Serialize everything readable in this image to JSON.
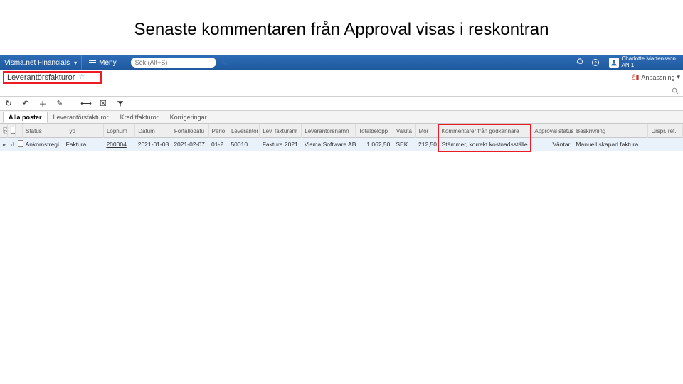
{
  "slide_title": "Senaste kommentaren från Approval visas i reskontran",
  "brand": "Visma.net Financials",
  "menu_label": "Meny",
  "search_placeholder": "Sök (Alt+S)",
  "user": {
    "name": "Charlotte Martensson",
    "org": "AN 1"
  },
  "breadcrumb": "Leverantörsfakturor",
  "anpassning_label": "Anpassning",
  "tabs": [
    "Alla poster",
    "Leverantörsfakturor",
    "Kreditfakturor",
    "Korrigeringar"
  ],
  "columns": {
    "status": "Status",
    "typ": "Typ",
    "lopnum": "Löpnum",
    "datum": "Datum",
    "forfallodatu": "Förfallodatu",
    "perio": "Perio",
    "leverantor": "Leverantör",
    "levfakturanr": "Lev. fakturanr",
    "leverantorsnamn": "Leverantörsnamn",
    "totalbelopp": "Totalbelopp",
    "valuta": "Valuta",
    "mor": "Mor",
    "kommentarer": "Kommentarer från godkännare",
    "approval_status": "Approval status",
    "beskrivning": "Beskrivning",
    "urspr_ref": "Urspr. ref."
  },
  "row": {
    "status": "Ankomstregi...",
    "typ": "Faktura",
    "lopnum": "200004",
    "datum": "2021-01-08",
    "forfallodatu": "2021-02-07",
    "perio": "01-2...",
    "leverantor": "50010",
    "levfakturanr": "Faktura 2021...",
    "leverantorsnamn": "Visma Software AB",
    "totalbelopp": "1 062,50",
    "valuta": "SEK",
    "mor": "212,50",
    "kommentarer": "Stämmer, korrekt kostnadsställe",
    "approval_status": "Väntar",
    "beskrivning": "Manuell skapad faktura",
    "urspr_ref": ""
  }
}
